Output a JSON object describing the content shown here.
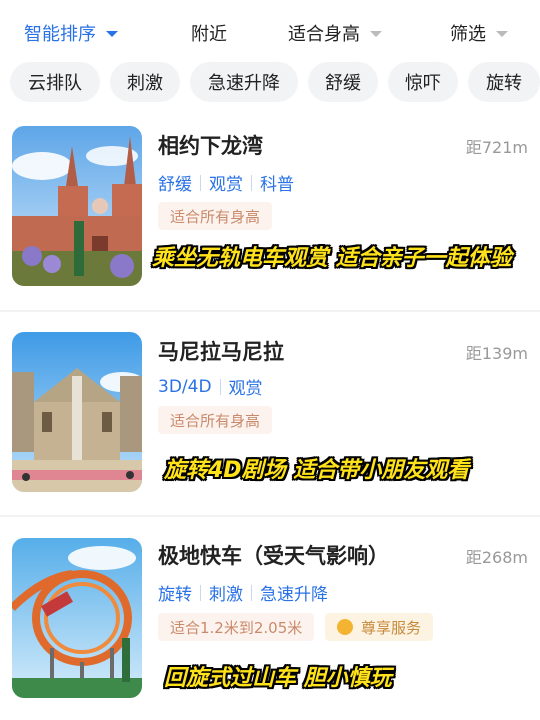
{
  "sort_bar": {
    "items": [
      {
        "label": "智能排序",
        "active": true
      },
      {
        "label": "附近"
      },
      {
        "label": "适合身高"
      },
      {
        "label": "筛选"
      }
    ]
  },
  "chips": [
    "云排队",
    "刺激",
    "急速升降",
    "舒缓",
    "惊吓",
    "旋转"
  ],
  "cards": [
    {
      "title": "相约下龙湾",
      "distance": "距721m",
      "tags": [
        "舒缓",
        "观赏",
        "科普"
      ],
      "height": "适合所有身高",
      "caption": "乘坐无轨电车观赏 适合亲子一起体验"
    },
    {
      "title": "马尼拉马尼拉",
      "distance": "距139m",
      "tags": [
        "3D/4D",
        "观赏"
      ],
      "height": "适合所有身高",
      "caption": "旋转4D剧场 适合带小朋友观看"
    },
    {
      "title": "极地快车（受天气影响）",
      "distance": "距268m",
      "tags": [
        "旋转",
        "刺激",
        "急速升降"
      ],
      "height": "适合1.2米到2.05米",
      "service": "尊享服务",
      "caption": "回旋式过山车 胆小慎玩"
    }
  ],
  "colors": {
    "accent": "#2a72e6",
    "caption": "#ffe21a"
  }
}
